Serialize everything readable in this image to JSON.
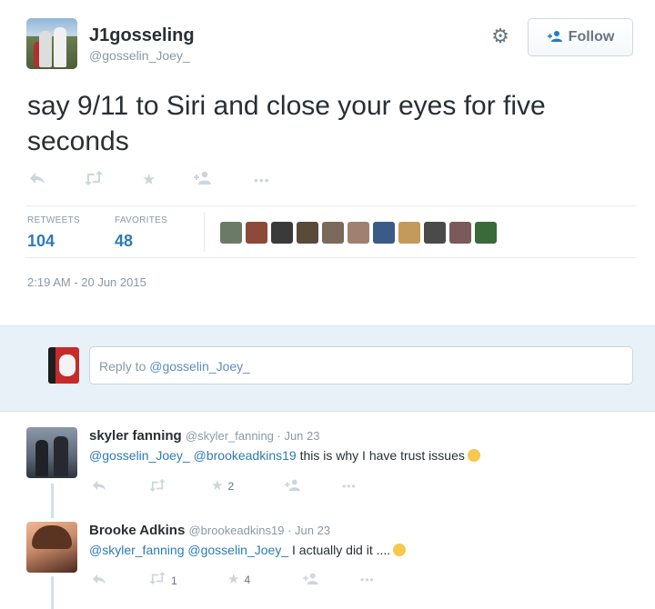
{
  "tweet": {
    "display_name": "J1gosseling",
    "screen_name": "@gosselin_Joey_",
    "text": "say 9/11 to Siri and close your eyes for five seconds",
    "follow_label": "Follow",
    "retweets_label": "RETWEETS",
    "retweets_count": "104",
    "favorites_label": "FAVORITES",
    "favorites_count": "48",
    "timestamp": "2:19 AM - 20 Jun 2015",
    "favoriter_colors": [
      "#6a7a66",
      "#8b4a3a",
      "#3a3a3a",
      "#5a4a3a",
      "#7a6a5a",
      "#a08070",
      "#3b5a88",
      "#c49a5a",
      "#4a4a4a",
      "#7a5a5a",
      "#3a6a3a"
    ],
    "icons": {
      "avatar": "user-photo-avatar",
      "gear": "gear-icon",
      "follow": "add-user-icon",
      "reply": "reply-icon",
      "retweet": "retweet-icon",
      "favorite": "star-icon",
      "follow_action": "follow-icon",
      "more": "more-icon"
    }
  },
  "reply_box": {
    "placeholder_prefix": "Reply to ",
    "placeholder_mention": "@gosselin_Joey_"
  },
  "replies": [
    {
      "name": "skyler fanning",
      "meta": "@skyler_fanning · Jun 23",
      "mention1": "@gosselin_Joey_",
      "mention2": "@brookeadkins19",
      "text": " this is why I have trust issues",
      "retweet_count": "",
      "favorite_count": "2"
    },
    {
      "name": "Brooke Adkins",
      "meta": "@brookeadkins19 · Jun 23",
      "mention1": "@skyler_fanning",
      "mention2": "@gosselin_Joey_",
      "text": " I actually did it ....",
      "retweet_count": "1",
      "favorite_count": "4"
    }
  ],
  "colors": {
    "link": "#2b7bb9",
    "muted": "#8899a6",
    "reply_band": "#e8f1f8"
  }
}
